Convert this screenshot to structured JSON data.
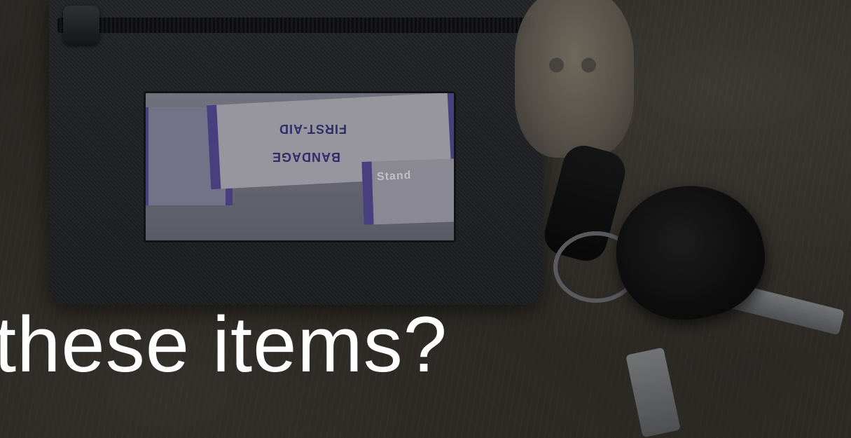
{
  "caption": {
    "text": "these items?"
  },
  "bandage_labels": {
    "label_1": "FIRST-AID",
    "label_2": "BANDAGE",
    "label_3": "Stand"
  },
  "colors": {
    "caption": "#ffffff",
    "pouch": "#25272b",
    "bandage_purple": "#5a4c9a"
  }
}
